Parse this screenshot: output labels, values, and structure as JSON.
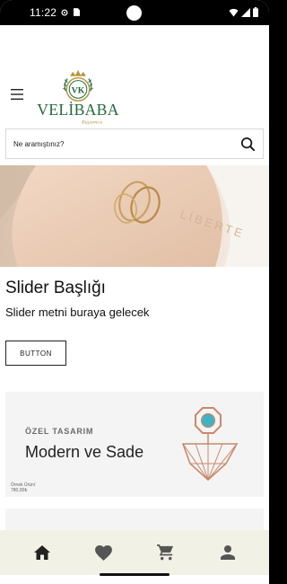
{
  "status_bar": {
    "time": "11:22"
  },
  "header": {
    "menu_icon": "hamburger-menu-icon",
    "logo_text": "VELİBABA",
    "logo_monogram": "VK",
    "logo_script": "Kuyumcu"
  },
  "search": {
    "placeholder": "Ne aramıştınız?",
    "value": "",
    "icon": "search-icon"
  },
  "slider": {
    "image_text": "LİBERTE",
    "title": "Slider Başlığı",
    "text": "Slider metni buraya gelecek",
    "button_label": "BUTTON"
  },
  "promo": {
    "kicker": "ÖZEL TASARIM",
    "title": "Modern ve Sade",
    "caption_line1": "Örnek Ürün/",
    "caption_line2": "780,00₺"
  },
  "bottom_nav": {
    "items": [
      {
        "icon": "home-icon"
      },
      {
        "icon": "heart-icon"
      },
      {
        "icon": "cart-icon"
      },
      {
        "icon": "user-icon"
      }
    ]
  },
  "colors": {
    "brand_green": "#1f6b3a",
    "brand_gold": "#b8943a",
    "nav_bg": "#f1f1e6"
  }
}
